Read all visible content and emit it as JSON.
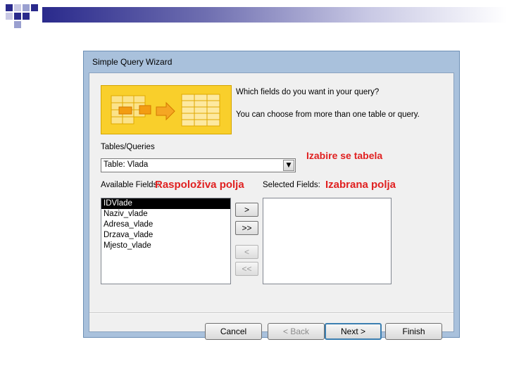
{
  "wizard": {
    "title": "Simple Query Wizard",
    "question": "Which fields do you want in your query?",
    "hint": "You can choose from more than one table or query.",
    "tables_label": "Tables/Queries",
    "table_value": "Table: Vlada",
    "available_label": "Available Fields:",
    "selected_label": "Selected Fields:",
    "available_fields": [
      "IDVlade",
      "Naziv_vlade",
      "Adresa_vlade",
      "Drzava_vlade",
      "Mjesto_vlade"
    ],
    "move_buttons": {
      "add_one": ">",
      "add_all": ">>",
      "remove_one": "<",
      "remove_all": "<<"
    },
    "buttons": {
      "cancel": "Cancel",
      "back": "< Back",
      "next": "Next >",
      "finish": "Finish"
    }
  },
  "annotations": {
    "tabela": "Izabire se tabela",
    "raspolozive": "Raspoloživa polja",
    "izabrana": "Izabrana polja"
  },
  "colors": {
    "annotation": "#e02020",
    "banner": "#f9cf2b",
    "selection": "#000000"
  }
}
